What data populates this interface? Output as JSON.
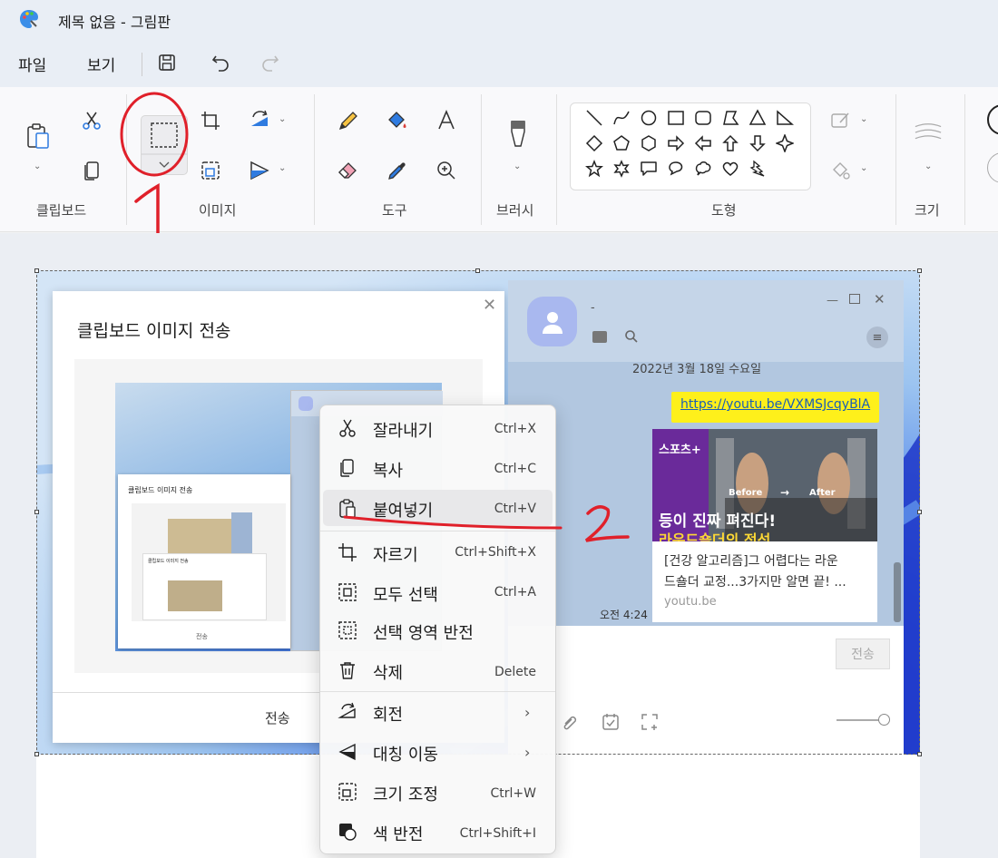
{
  "window": {
    "title": "제목 없음 - 그림판"
  },
  "menu": {
    "file": "파일",
    "view": "보기"
  },
  "ribbon": {
    "groups": {
      "clipboard": "클립보드",
      "image": "이미지",
      "tools": "도구",
      "brush": "브러시",
      "shapes": "도형",
      "size": "크기"
    }
  },
  "annotations": {
    "mark1": "1",
    "mark2": "2"
  },
  "dialog": {
    "title": "클립보드 이미지 전송",
    "send": "전송",
    "mini_title": "클립보드 이미지 전송",
    "mini_title2": "클립보드 이미지 전송",
    "mini_send": "전송"
  },
  "chat": {
    "name": "-",
    "date": "2022년 3월 18일 수요일",
    "link": "https://youtu.be/VXMSJcqyBlA",
    "card": {
      "logo": "스포츠+",
      "headline1": "등이 진짜 펴진다!",
      "headline2": "라운드숄더의 정석",
      "before": "Before",
      "after": "After",
      "text_line1": "[건강 알고리즘]그 어렵다는 라운",
      "text_line2": "드숄더 교정...3가지만 알면 끝! ...",
      "domain": "youtu.be"
    },
    "time": "오전 4:24",
    "send": "전송"
  },
  "context_menu": {
    "items": [
      {
        "label": "잘라내기",
        "shortcut": "Ctrl+X"
      },
      {
        "label": "복사",
        "shortcut": "Ctrl+C"
      },
      {
        "label": "붙여넣기",
        "shortcut": "Ctrl+V"
      },
      {
        "label": "자르기",
        "shortcut": "Ctrl+Shift+X"
      },
      {
        "label": "모두 선택",
        "shortcut": "Ctrl+A"
      },
      {
        "label": "선택 영역 반전",
        "shortcut": ""
      },
      {
        "label": "삭제",
        "shortcut": "Delete"
      },
      {
        "label": "회전",
        "shortcut": ""
      },
      {
        "label": "대칭 이동",
        "shortcut": ""
      },
      {
        "label": "크기 조정",
        "shortcut": "Ctrl+W"
      },
      {
        "label": "색 반전",
        "shortcut": "Ctrl+Shift+I"
      }
    ],
    "submenu_arrow": "›"
  },
  "colors": {
    "accent": "#2f5fd0",
    "annotation_red": "#e0202a",
    "kakao_yellow": "#fef01b"
  }
}
